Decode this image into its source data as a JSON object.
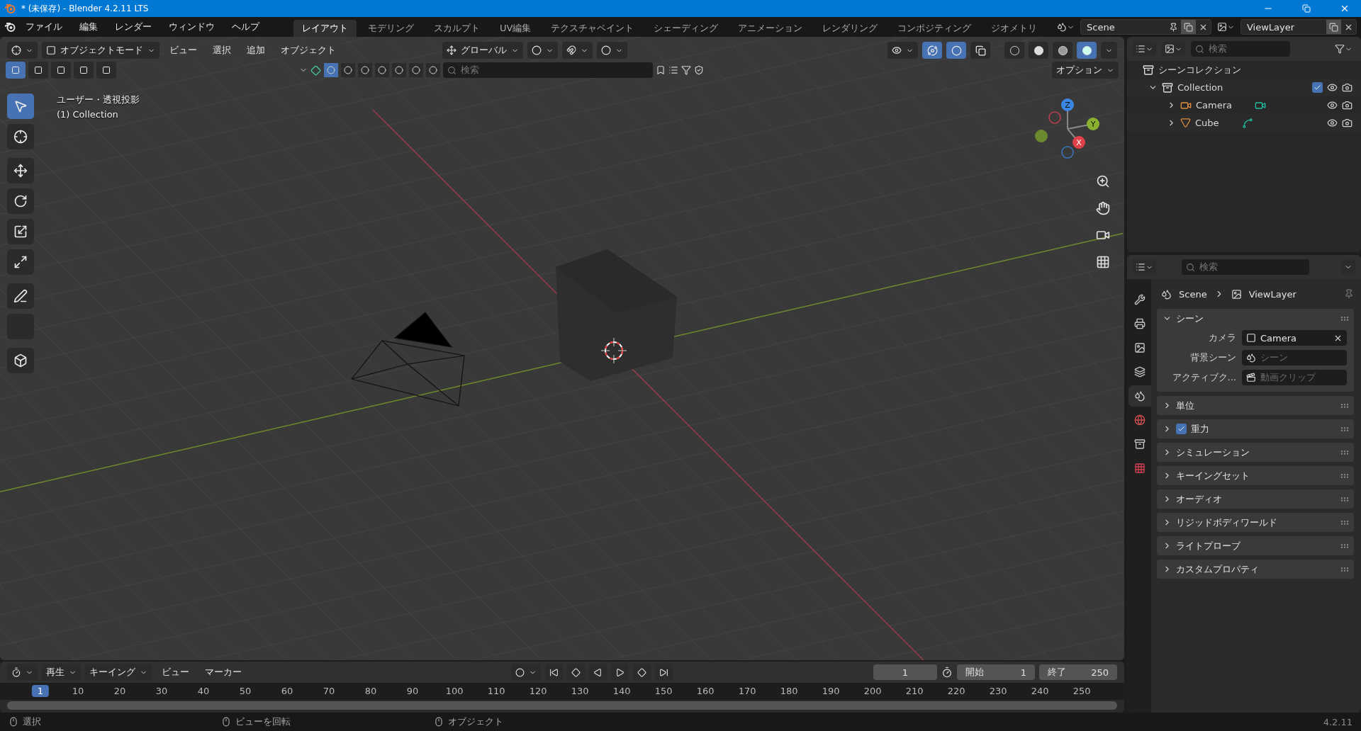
{
  "window": {
    "title": "* (未保存) - Blender 4.2.11 LTS"
  },
  "menu": [
    "ファイル",
    "編集",
    "レンダー",
    "ウィンドウ",
    "ヘルプ"
  ],
  "workspaces": [
    {
      "label": "レイアウト",
      "selected": true
    },
    {
      "label": "モデリング",
      "selected": false
    },
    {
      "label": "スカルプト",
      "selected": false
    },
    {
      "label": "UV編集",
      "selected": false
    },
    {
      "label": "テクスチャペイント",
      "selected": false
    },
    {
      "label": "シェーディング",
      "selected": false
    },
    {
      "label": "アニメーション",
      "selected": false
    },
    {
      "label": "レンダリング",
      "selected": false
    },
    {
      "label": "コンポジティング",
      "selected": false
    },
    {
      "label": "ジオメトリ",
      "selected": false
    }
  ],
  "scene_field": "Scene",
  "view_layer_field": "ViewLayer",
  "viewport": {
    "header": {
      "mode": "オブジェクトモード",
      "menus": [
        "ビュー",
        "選択",
        "追加",
        "オブジェクト"
      ],
      "orientation": "グローバル",
      "toggles": [
        {
          "kind": "gizmo",
          "on": true
        },
        {
          "kind": "overlay",
          "on": true
        },
        {
          "kind": "xray",
          "on": false
        }
      ],
      "shading": [
        {
          "kind": "wireframe",
          "selected": false
        },
        {
          "kind": "solid",
          "selected": false
        },
        {
          "kind": "material",
          "selected": false
        },
        {
          "kind": "rendered",
          "selected": true
        }
      ]
    },
    "tool_header": {
      "select_modes": [
        {
          "selected": true
        },
        {
          "selected": false
        },
        {
          "selected": false
        },
        {
          "selected": false
        },
        {
          "selected": false
        }
      ],
      "search_placeholder": "検索",
      "options": "オプション"
    },
    "overlay": [
      "ユーザー・透視投影",
      "(1) Collection"
    ],
    "tool_groups": [
      [
        {
          "kind": "select",
          "selected": true
        },
        {
          "kind": "cursor",
          "selected": false
        }
      ],
      [
        {
          "kind": "move",
          "selected": false
        },
        {
          "kind": "rotate",
          "selected": false
        },
        {
          "kind": "scale",
          "selected": false
        },
        {
          "kind": "transform",
          "selected": false
        }
      ],
      [
        {
          "kind": "annotate",
          "selected": false
        },
        {
          "kind": "measure",
          "selected": false
        }
      ],
      [
        {
          "kind": "add_cube",
          "selected": false
        }
      ]
    ],
    "gizmo_axes": [
      "X",
      "Y",
      "Z"
    ]
  },
  "outliner": {
    "search_placeholder": "検索",
    "root": "シーンコレクション",
    "tree": [
      {
        "label": "Collection",
        "kind": "collection",
        "expanded": true,
        "checked": true,
        "children": [
          {
            "label": "Camera",
            "kind": "camera",
            "expanded": false
          },
          {
            "label": "Cube",
            "kind": "mesh",
            "expanded": false
          }
        ]
      }
    ]
  },
  "properties": {
    "search_placeholder": "検索",
    "tabs": [
      {
        "kind": "tool",
        "selected": false
      },
      {
        "kind": "render",
        "selected": false
      },
      {
        "kind": "output",
        "selected": false
      },
      {
        "kind": "view_layer",
        "selected": false
      },
      {
        "kind": "scene",
        "selected": true
      },
      {
        "kind": "world",
        "selected": false
      },
      {
        "kind": "collection",
        "selected": false
      },
      {
        "kind": "texture",
        "selected": false
      }
    ],
    "breadcrumb": [
      "Scene",
      "ViewLayer"
    ],
    "panels": [
      {
        "label": "シーン",
        "expanded": true,
        "fields": [
          {
            "label": "カメラ",
            "value": "Camera",
            "kind": "camera"
          },
          {
            "label": "背景シーン",
            "placeholder": "シーン",
            "kind": "scene"
          },
          {
            "label": "アクティブク...",
            "placeholder": "動画クリップ",
            "kind": "clip"
          }
        ]
      },
      {
        "label": "単位",
        "expanded": false
      },
      {
        "label": "重力",
        "expanded": false,
        "checked": true
      },
      {
        "label": "シミュレーション",
        "expanded": false
      },
      {
        "label": "キーイングセット",
        "expanded": false
      },
      {
        "label": "オーディオ",
        "expanded": false
      },
      {
        "label": "リジッドボディワールド",
        "expanded": false
      },
      {
        "label": "ライトプローブ",
        "expanded": false
      },
      {
        "label": "カスタムプロパティ",
        "expanded": false
      }
    ]
  },
  "timeline": {
    "menus": [
      {
        "label": "再生",
        "dropdown": true
      },
      {
        "label": "キーイング",
        "dropdown": true
      },
      {
        "label": "ビュー",
        "dropdown": false
      },
      {
        "label": "マーカー",
        "dropdown": false
      }
    ],
    "current_frame": "1",
    "start_label": "開始",
    "start": "1",
    "end_label": "終了",
    "end": "250",
    "ruler": [
      {
        "label": "1",
        "selected": true
      },
      {
        "label": "10",
        "selected": false
      },
      {
        "label": "20",
        "selected": false
      },
      {
        "label": "30",
        "selected": false
      },
      {
        "label": "40",
        "selected": false
      },
      {
        "label": "50",
        "selected": false
      },
      {
        "label": "60",
        "selected": false
      },
      {
        "label": "70",
        "selected": false
      },
      {
        "label": "80",
        "selected": false
      },
      {
        "label": "90",
        "selected": false
      },
      {
        "label": "100",
        "selected": false
      },
      {
        "label": "110",
        "selected": false
      },
      {
        "label": "120",
        "selected": false
      },
      {
        "label": "130",
        "selected": false
      },
      {
        "label": "140",
        "selected": false
      },
      {
        "label": "150",
        "selected": false
      },
      {
        "label": "160",
        "selected": false
      },
      {
        "label": "170",
        "selected": false
      },
      {
        "label": "180",
        "selected": false
      },
      {
        "label": "190",
        "selected": false
      },
      {
        "label": "200",
        "selected": false
      },
      {
        "label": "210",
        "selected": false
      },
      {
        "label": "220",
        "selected": false
      },
      {
        "label": "230",
        "selected": false
      },
      {
        "label": "240",
        "selected": false
      },
      {
        "label": "250",
        "selected": false
      }
    ]
  },
  "status_bar": {
    "hints": [
      "選択",
      "ビューを回転",
      "オブジェクト"
    ],
    "version": "4.2.11"
  }
}
